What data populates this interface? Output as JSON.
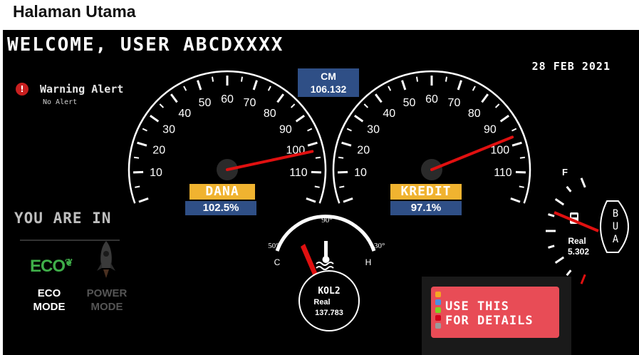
{
  "page": {
    "title": "Halaman Utama"
  },
  "header": {
    "welcome": "WELCOME, USER ABCDXXXX",
    "date": "28 FEB 2021"
  },
  "warning": {
    "title": "Warning Alert",
    "status": "No Alert"
  },
  "cm": {
    "label": "CM",
    "value": "106.132"
  },
  "gauge_dana": {
    "label": "DANA",
    "value": "102.5%",
    "needle_value": 102.5,
    "ticks": [
      "10",
      "20",
      "30",
      "40",
      "50",
      "60",
      "70",
      "80",
      "90",
      "100",
      "110"
    ]
  },
  "gauge_kredit": {
    "label": "KREDIT",
    "value": "97.1%",
    "needle_value": 97.1,
    "ticks": [
      "10",
      "20",
      "30",
      "40",
      "50",
      "60",
      "70",
      "80",
      "90",
      "100",
      "110"
    ]
  },
  "temp_gauge": {
    "min_label": "50°",
    "mid_label": "90°",
    "max_label": "130°",
    "cold_label": "C",
    "hot_label": "H",
    "name": "KOL2",
    "real_label": "Real",
    "real_value": "137.783"
  },
  "fuel_gauge": {
    "full_label": "F",
    "name": "BUA",
    "real_label": "Real",
    "real_value": "5.302"
  },
  "mode": {
    "heading": "YOU ARE IN",
    "eco_logo": "ECO",
    "eco_label_1": "ECO",
    "eco_label_2": "MODE",
    "power_label_1": "POWER",
    "power_label_2": "MODE"
  },
  "cta": {
    "line1": "USE THIS",
    "line2": "FOR DETAILS"
  },
  "colors": {
    "accent_blue": "#2f4f86",
    "accent_yellow": "#f0b330",
    "needle": "#e01010",
    "cta": "#e84c56",
    "eco_green": "#3fae49"
  }
}
